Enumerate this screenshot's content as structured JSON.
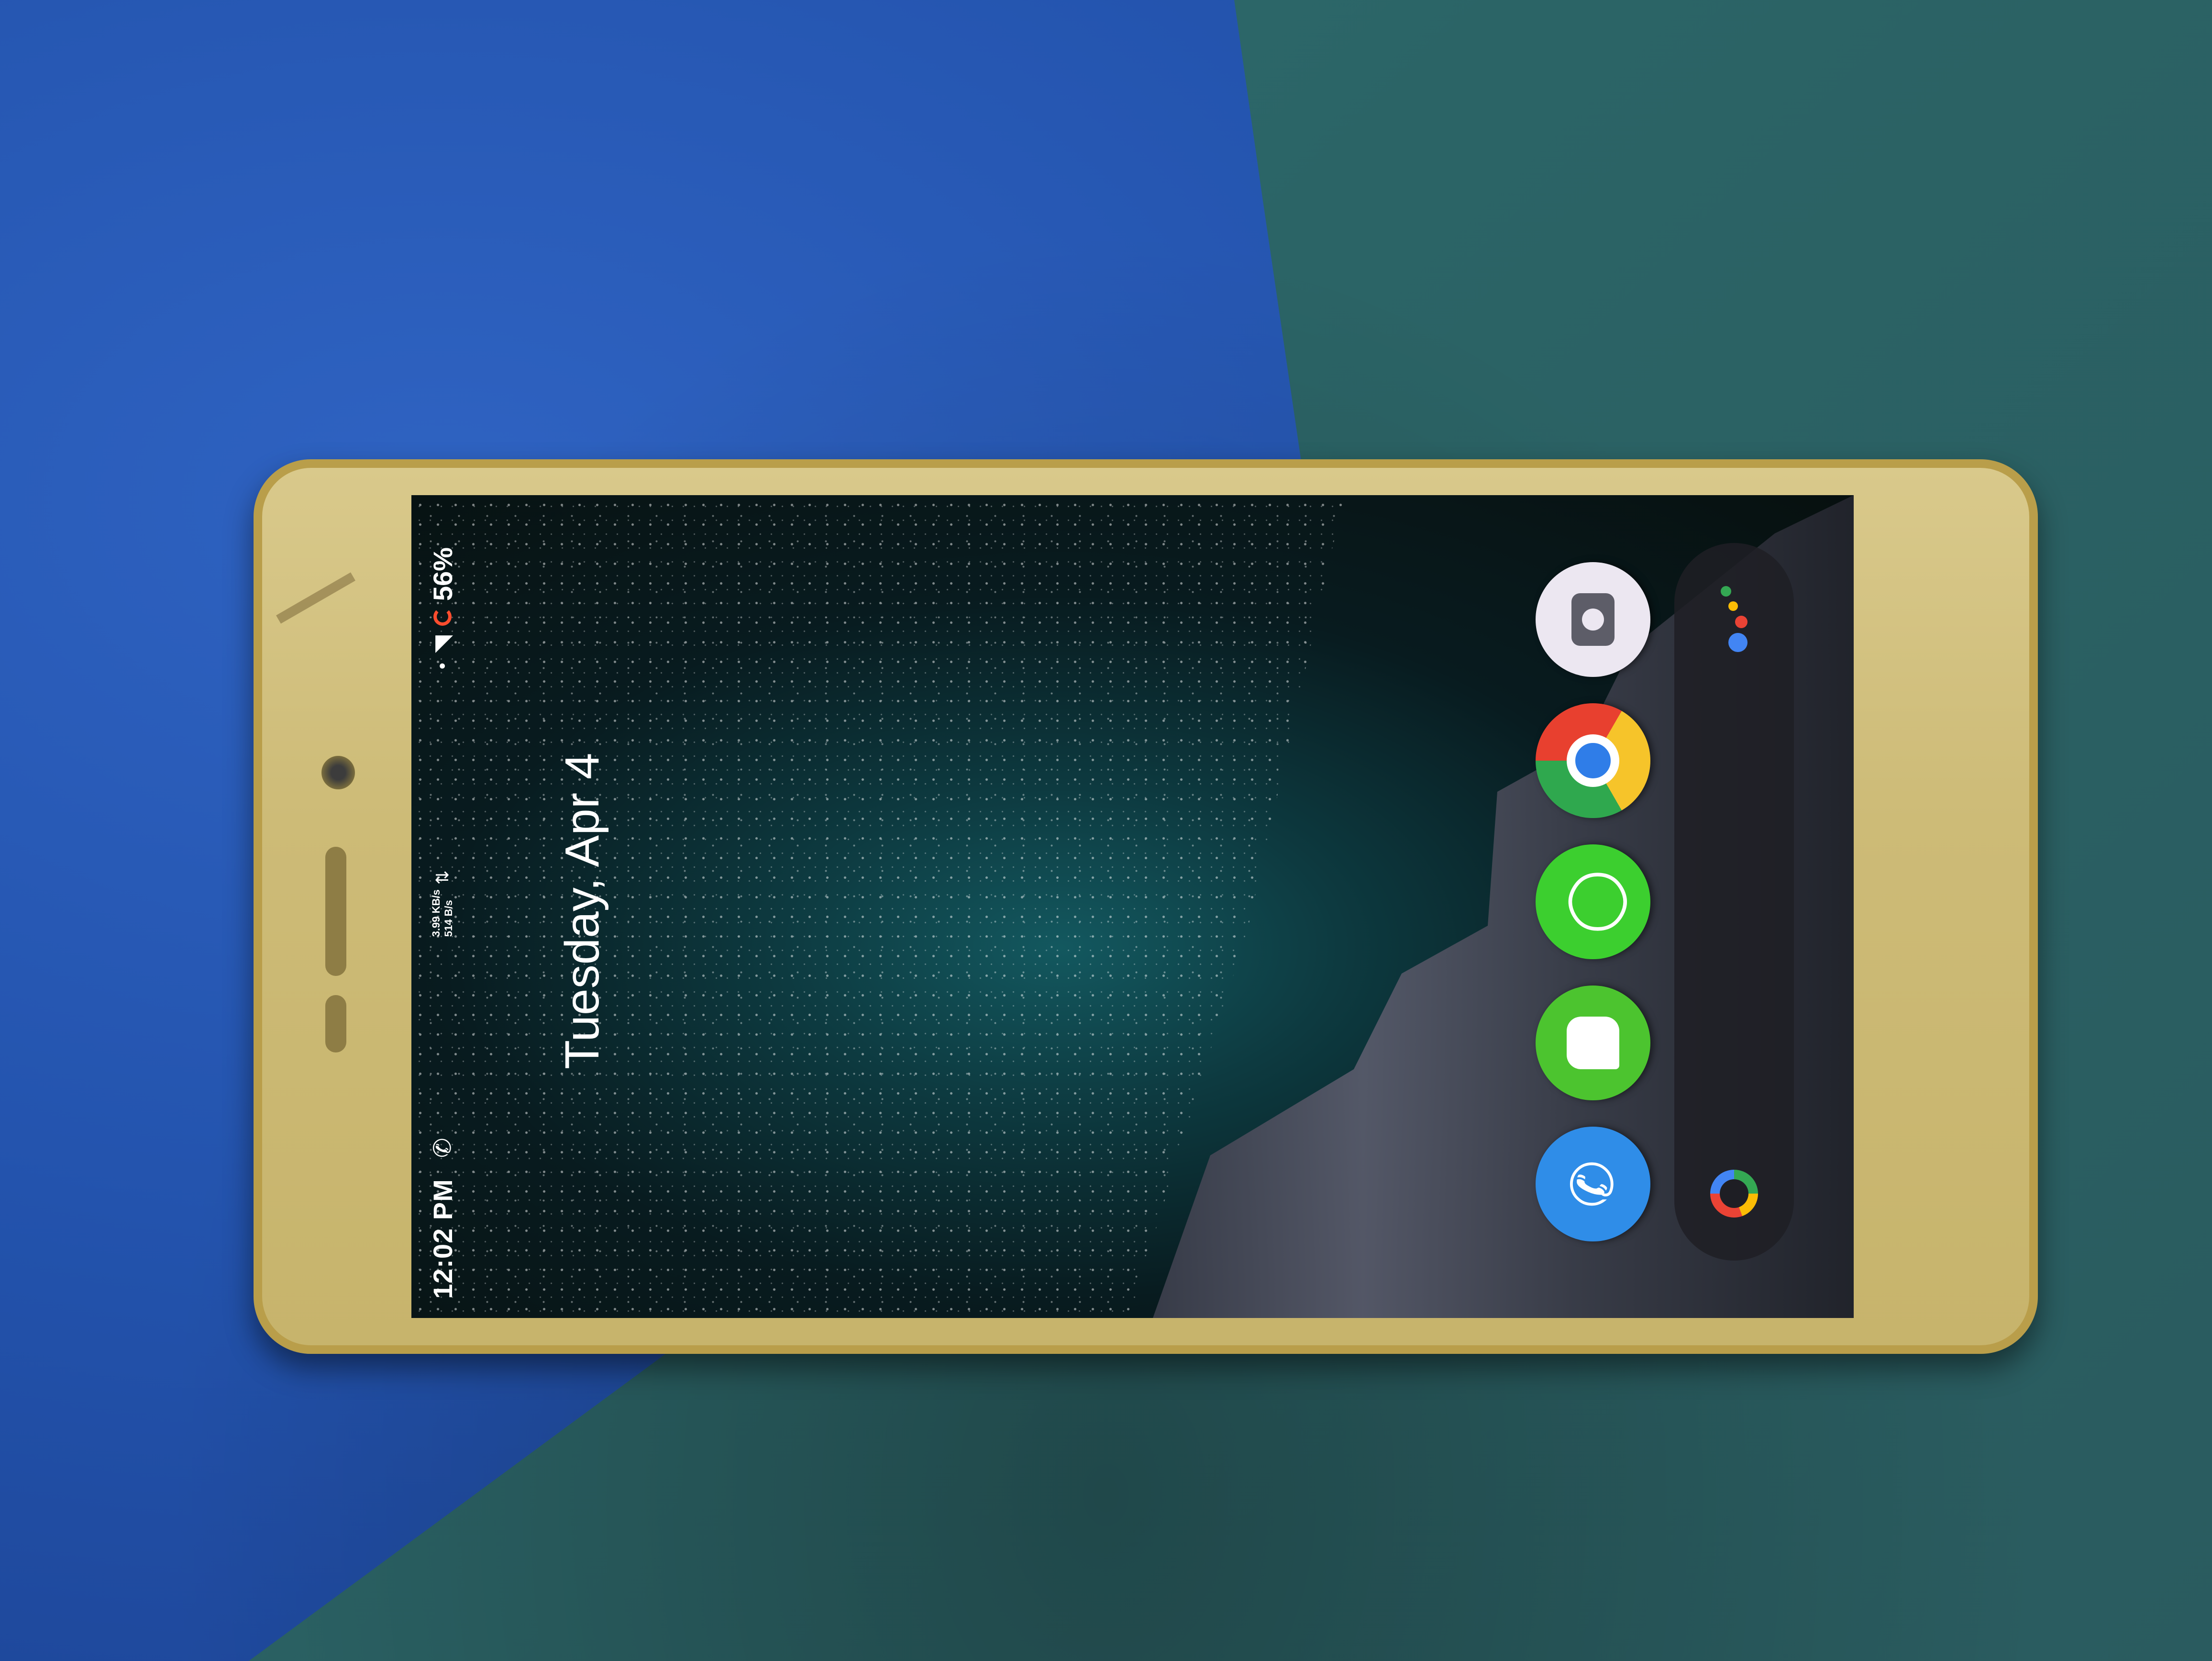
{
  "status_bar": {
    "time": "12:02 PM",
    "net_down": "3.99 KB/s",
    "net_up": "514 B/s",
    "battery": "56%"
  },
  "home": {
    "date": "Tuesday, Apr 4"
  },
  "dock": {
    "apps": [
      "phone",
      "messages",
      "whatsapp",
      "chrome",
      "camera"
    ]
  },
  "colors": {
    "phone_body": "#cdbb77",
    "fabric_blue": "#2353ad",
    "fabric_green": "#2b6466",
    "battery_ring": "#ff4d2e"
  }
}
